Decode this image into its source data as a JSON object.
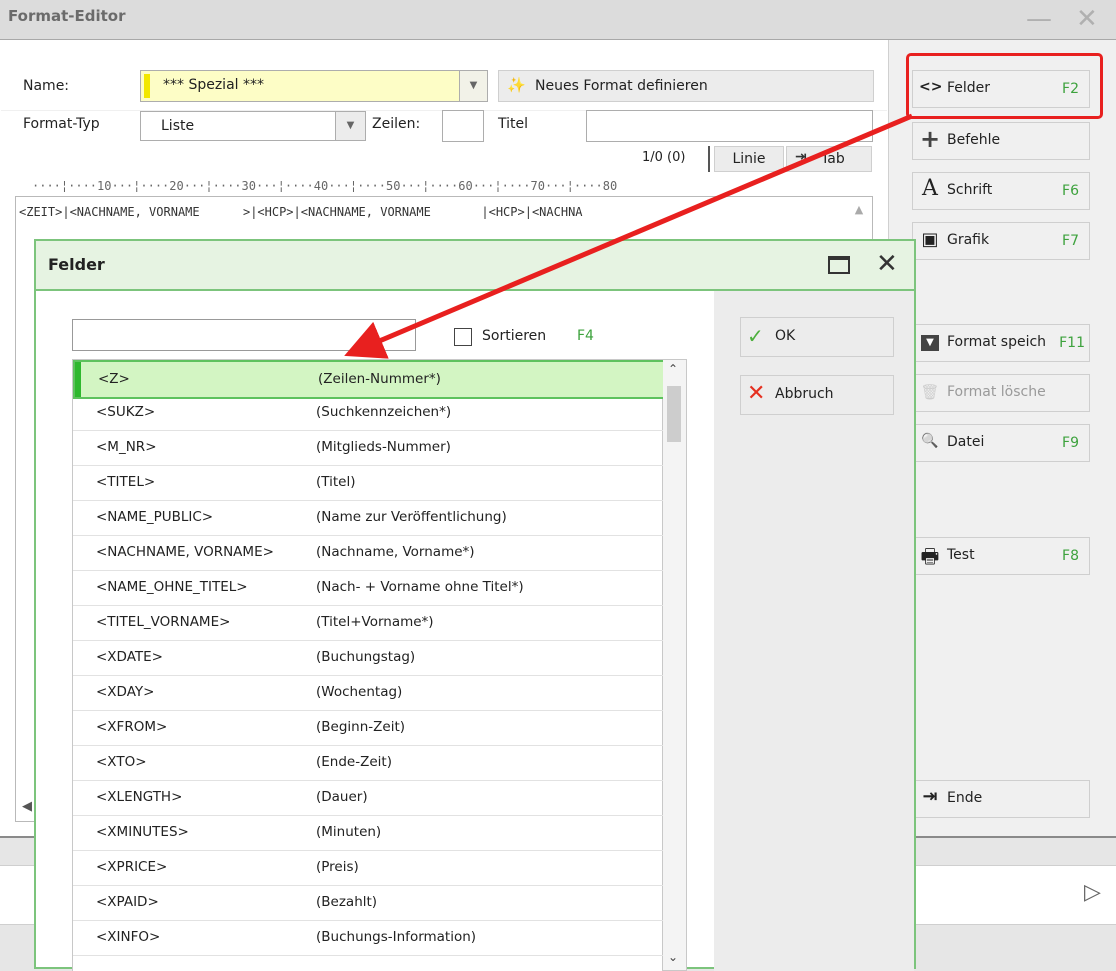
{
  "window": {
    "title": "Format-Editor",
    "minimize_glyph": "—",
    "close_glyph": "✕"
  },
  "form": {
    "name_label": "Name:",
    "name_value": "*** Spezial ***",
    "neues_format_label": "Neues Format definieren",
    "format_typ_label": "Format-Typ",
    "format_typ_value": "Liste",
    "zeilen_label": "Zeilen:",
    "zeilen_value": "",
    "titel_label": "Titel",
    "titel_value": "",
    "counter": "1/0 (0)",
    "linie_label": "Linie",
    "tab_label": "Tab"
  },
  "ruler": "····¦····10···¦····20···¦····30···¦····40···¦····50···¦····60···¦····70···¦····80",
  "code_line": "<ZEIT>|<NACHNAME, VORNAME      >|<HCP>|<NACHNAME, VORNAME       |<HCP>|<NACHNA",
  "side_buttons": [
    {
      "id": "felder",
      "icon": "code-brackets-icon",
      "glyph": "<>",
      "label": "Felder",
      "fkey": "F2"
    },
    {
      "id": "befehle",
      "icon": "plus-icon",
      "glyph": "+",
      "label": "Befehle",
      "fkey": ""
    },
    {
      "id": "schrift",
      "icon": "font-icon",
      "glyph": "A",
      "label": "Schrift",
      "fkey": "F6"
    },
    {
      "id": "grafik",
      "icon": "image-icon",
      "glyph": "▣",
      "label": "Grafik",
      "fkey": "F7"
    },
    {
      "id": "format-speichern",
      "icon": "save-folder-icon",
      "glyph": "▼",
      "label": "Format speich",
      "fkey": "F11"
    },
    {
      "id": "format-loeschen",
      "icon": "trash-icon",
      "glyph": "🗑",
      "label": "Format lösche",
      "fkey": ""
    },
    {
      "id": "datei",
      "icon": "folder-search-icon",
      "glyph": "🔍",
      "label": "Datei",
      "fkey": "F9"
    },
    {
      "id": "test",
      "icon": "printer-icon",
      "glyph": "🖶",
      "label": "Test",
      "fkey": "F8"
    },
    {
      "id": "ende",
      "icon": "exit-icon",
      "glyph": "⇥",
      "label": "Ende",
      "fkey": ""
    }
  ],
  "felder": {
    "title": "Felder",
    "search_value": "",
    "sortieren_label": "Sortieren",
    "sortieren_fkey": "F4",
    "ok_label": "OK",
    "abbruch_label": "Abbruch",
    "rows": [
      {
        "field": "<Z>",
        "desc": "(Zeilen-Nummer*)"
      },
      {
        "field": "<SUKZ>",
        "desc": "(Suchkennzeichen*)"
      },
      {
        "field": "<M_NR>",
        "desc": "(Mitglieds-Nummer)"
      },
      {
        "field": "<TITEL>",
        "desc": "(Titel)"
      },
      {
        "field": "<NAME_PUBLIC>",
        "desc": "(Name zur Veröffentlichung)"
      },
      {
        "field": "<NACHNAME, VORNAME>",
        "desc": "(Nachname, Vorname*)"
      },
      {
        "field": "<NAME_OHNE_TITEL>",
        "desc": "(Nach- + Vorname ohne Titel*)"
      },
      {
        "field": "<TITEL_VORNAME>",
        "desc": "(Titel+Vorname*)"
      },
      {
        "field": "<XDATE>",
        "desc": "(Buchungstag)"
      },
      {
        "field": "<XDAY>",
        "desc": "(Wochentag)"
      },
      {
        "field": "<XFROM>",
        "desc": "(Beginn-Zeit)"
      },
      {
        "field": "<XTO>",
        "desc": "(Ende-Zeit)"
      },
      {
        "field": "<XLENGTH>",
        "desc": "(Dauer)"
      },
      {
        "field": "<XMINUTES>",
        "desc": "(Minuten)"
      },
      {
        "field": "<XPRICE>",
        "desc": "(Preis)"
      },
      {
        "field": "<XPAID>",
        "desc": "(Bezahlt)"
      },
      {
        "field": "<XINFO>",
        "desc": "(Buchungs-Information)"
      }
    ]
  },
  "colors": {
    "accent_green": "#5ec25e",
    "annotation_red": "#e8201f",
    "fkey_green": "#3da23d"
  }
}
